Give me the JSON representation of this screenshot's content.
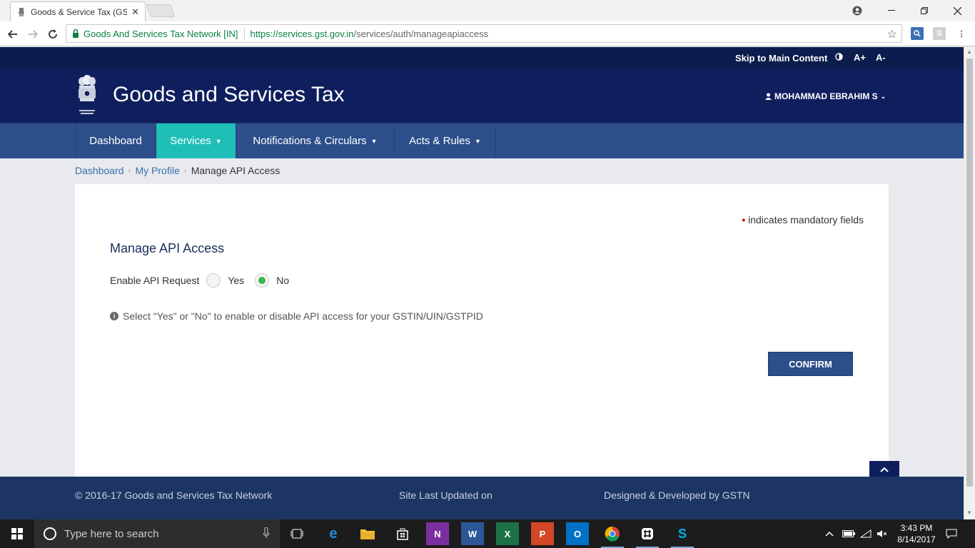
{
  "browser": {
    "tab_title": "Goods & Service Tax (GS",
    "tab_close": "✕",
    "secure_label": "Goods And Services Tax Network [IN]",
    "url_host": "https://services.gst.gov.in",
    "url_path": "/services/auth/manageapiaccess"
  },
  "topbar": {
    "skip_link": "Skip to Main Content",
    "font_increase": "A+",
    "font_decrease": "A-"
  },
  "header": {
    "site_title": "Goods and Services Tax",
    "user_name": "MOHAMMAD EBRAHIM S"
  },
  "nav": {
    "items": [
      {
        "label": "Dashboard"
      },
      {
        "label": "Services"
      },
      {
        "label": "Notifications & Circulars"
      },
      {
        "label": "Acts & Rules"
      }
    ]
  },
  "breadcrumb": {
    "items": [
      "Dashboard",
      "My Profile",
      "Manage API Access"
    ]
  },
  "form": {
    "mandatory_note": "indicates mandatory fields",
    "title": "Manage API Access",
    "field_label": "Enable API Request",
    "option_yes": "Yes",
    "option_no": "No",
    "selected": "No",
    "info_text": "Select \"Yes\" or \"No\" to enable or disable API access for your GSTIN/UIN/GSTPID",
    "confirm_label": "CONFIRM"
  },
  "footer": {
    "copyright": "© 2016-17 Goods and Services Tax Network",
    "last_updated": "Site Last Updated on",
    "designed_by": "Designed & Developed by GSTN"
  },
  "taskbar": {
    "search_placeholder": "Type here to search",
    "time": "3:43 PM",
    "date": "8/14/2017"
  },
  "colors": {
    "header_bg": "#0f1f5e",
    "nav_bg": "#2c4e8a",
    "nav_active": "#1fbfb8",
    "footer_bg": "#1c3563",
    "radio_selected": "#3db34a"
  }
}
